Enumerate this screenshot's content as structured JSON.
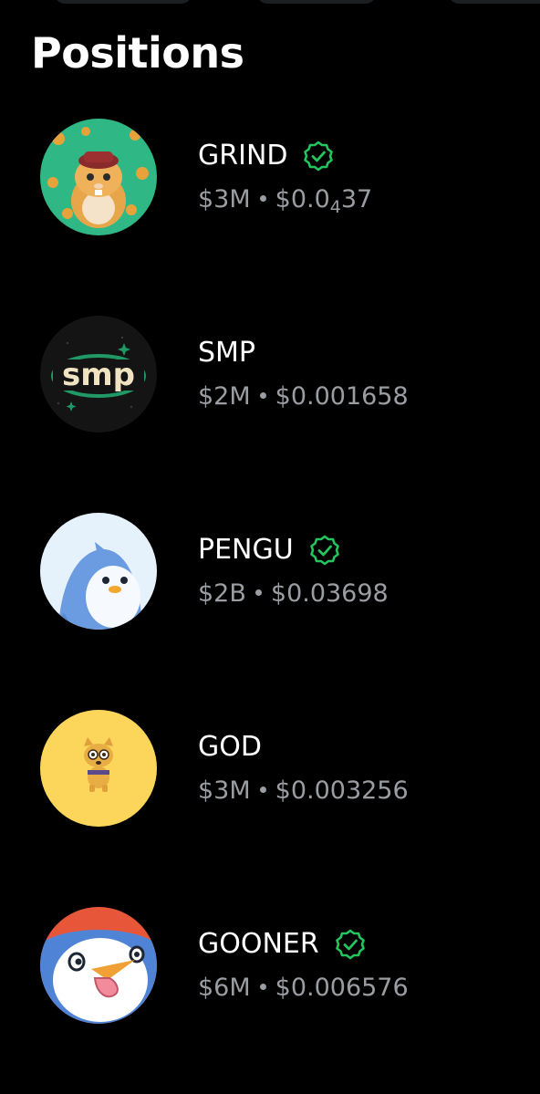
{
  "page": {
    "title": "Positions"
  },
  "colors": {
    "background": "#000000",
    "text_primary": "#ffffff",
    "text_secondary": "#9a9ea3",
    "verified": "#22c55e"
  },
  "positions": [
    {
      "name": "GRIND",
      "verified": true,
      "market_cap": "$3M",
      "price_prefix": "$0.0",
      "price_subscript": "4",
      "price_suffix": "37",
      "avatar_icon": "hamster-icon"
    },
    {
      "name": "SMP",
      "verified": false,
      "market_cap": "$2M",
      "price_prefix": "$0.001658",
      "price_subscript": "",
      "price_suffix": "",
      "avatar_icon": "smp-logo-icon",
      "avatar_text": "smp"
    },
    {
      "name": "PENGU",
      "verified": true,
      "market_cap": "$2B",
      "price_prefix": "$0.03698",
      "price_subscript": "",
      "price_suffix": "",
      "avatar_icon": "penguin-icon"
    },
    {
      "name": "GOD",
      "verified": false,
      "market_cap": "$3M",
      "price_prefix": "$0.003256",
      "price_subscript": "",
      "price_suffix": "",
      "avatar_icon": "dog-icon"
    },
    {
      "name": "GOONER",
      "verified": true,
      "market_cap": "$6M",
      "price_prefix": "$0.006576",
      "price_subscript": "",
      "price_suffix": "",
      "avatar_icon": "penguin-tongue-icon"
    }
  ]
}
